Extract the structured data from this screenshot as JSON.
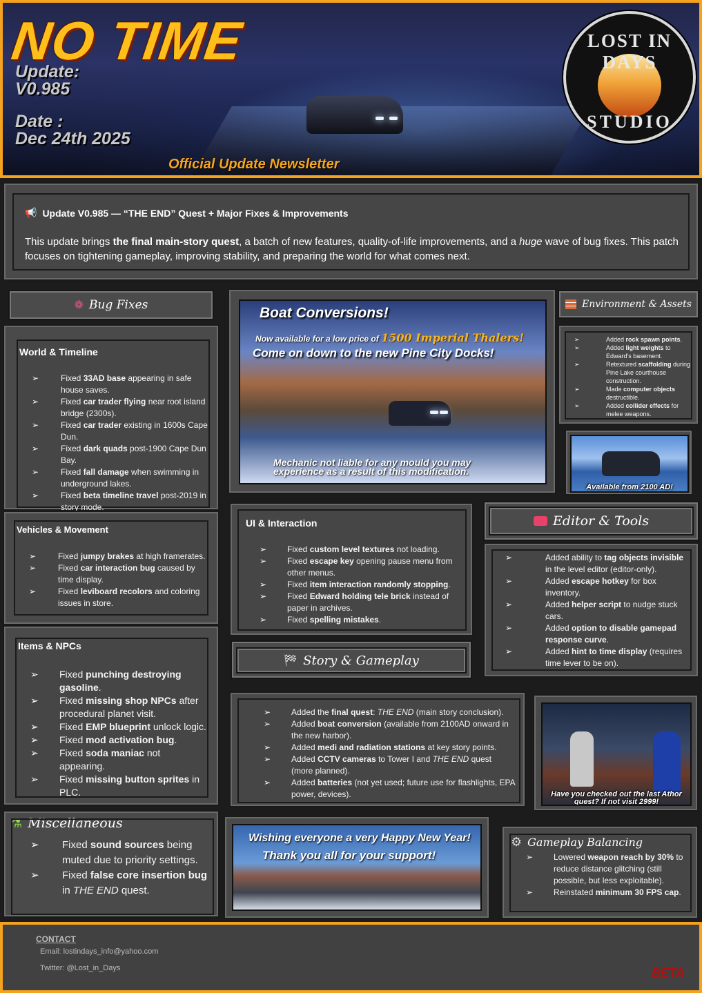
{
  "header": {
    "title": "NO TIME",
    "update_label": "Update:",
    "version": "V0.985",
    "date_label": "Date :",
    "date": "Dec 24th 2025",
    "newsletter": "Official Update Newsletter",
    "studio_top": "LOST IN DAYS",
    "studio_bottom": "STUDIO"
  },
  "intro": {
    "title": "Update V0.985 — “THE END” Quest + Major Fixes & Improvements",
    "body_1": "This update brings ",
    "body_bold": "the final main-story quest",
    "body_2": ", a batch of new features, quality-of-life improvements, and a ",
    "body_italic": "huge",
    "body_3": " wave of bug fixes. This patch focuses on tightening gameplay, improving stability, and preparing the world for what comes next."
  },
  "bug_fixes": {
    "heading": "Bug Fixes",
    "world": {
      "title": "World & Timeline",
      "items": [
        [
          "Fixed ",
          "33AD base",
          " appearing in safe house saves."
        ],
        [
          "Fixed ",
          "car trader flying",
          " near root island bridge (2300s)."
        ],
        [
          "Fixed ",
          "car trader",
          " existing in 1600s Cape Dun."
        ],
        [
          "Fixed ",
          "dark quads",
          " post-1900 Cape Dun Bay."
        ],
        [
          "Fixed ",
          "fall damage",
          " when swimming in underground lakes."
        ],
        [
          "Fixed ",
          "beta timeline travel",
          " post-2019 in story mode."
        ]
      ]
    },
    "vehicles": {
      "title": "Vehicles & Movement",
      "items": [
        [
          "Fixed ",
          "jumpy brakes",
          " at high framerates."
        ],
        [
          "Fixed ",
          "car interaction bug",
          " caused by time display."
        ],
        [
          "Fixed ",
          "leviboard recolors",
          " and coloring issues in store."
        ]
      ]
    },
    "items_npcs": {
      "title": "Items & NPCs",
      "items": [
        [
          "Fixed ",
          "punching destroying gasoline",
          "."
        ],
        [
          "Fixed ",
          "missing shop NPCs",
          " after procedural planet visit."
        ],
        [
          "Fixed ",
          "EMP blueprint",
          " unlock logic."
        ],
        [
          "Fixed ",
          "mod activation bug",
          "."
        ],
        [
          "Fixed ",
          "soda maniac",
          " not appearing."
        ],
        [
          "Fixed ",
          "missing button sprites",
          " in PLC."
        ]
      ]
    }
  },
  "misc": {
    "heading": "Miscellaneous",
    "items": [
      [
        "Fixed ",
        "sound sources",
        " being muted due to priority settings."
      ],
      [
        "Fixed ",
        "false core insertion bug",
        " in ",
        "THE END",
        " quest."
      ]
    ]
  },
  "boat_ad": {
    "title": "Boat Conversions!",
    "price_pre": "Now available for a low price of",
    "price": "1500 Imperial Thalers!",
    "tagline": "Come on down to the new Pine City Docks!",
    "disclaimer": "Mechanic not liable for any mould you may experience as a result of this modification."
  },
  "ui": {
    "title": "UI & Interaction",
    "items": [
      [
        "Fixed ",
        "custom level textures",
        " not loading."
      ],
      [
        "Fixed ",
        "escape key",
        " opening pause menu from other menus."
      ],
      [
        "Fixed ",
        "item interaction randomly stopping",
        "."
      ],
      [
        "Fixed ",
        "Edward holding tele brick",
        " instead of paper in archives."
      ],
      [
        "Fixed ",
        "spelling mistakes",
        "."
      ]
    ]
  },
  "story": {
    "heading": "Story & Gameplay",
    "items": [
      [
        "Added the ",
        "final quest",
        ": ",
        "THE END",
        " (main story conclusion)."
      ],
      [
        "Added ",
        "boat conversion",
        " (available from 2100AD onward in the new harbor).",
        "",
        ""
      ],
      [
        "Added ",
        "medi and radiation stations",
        " at key story points.",
        "",
        ""
      ],
      [
        "Added ",
        "CCTV cameras",
        " to Tower I and ",
        "THE END",
        " quest (more planned)."
      ],
      [
        "Added ",
        "batteries",
        " (not yet used; future use for flashlights, EPA power, devices).",
        "",
        ""
      ]
    ]
  },
  "environment": {
    "heading": "Environment & Assets",
    "items": [
      [
        "Added ",
        "rock spawn points",
        "."
      ],
      [
        "Added ",
        "light weights",
        " to Edward's basement."
      ],
      [
        "Retextured ",
        "scaffolding",
        " during Pine Lake courthouse construction."
      ],
      [
        "Made ",
        "computer objects",
        " destructible."
      ],
      [
        "Added ",
        "collider effects",
        " for melee weapons."
      ]
    ],
    "image_caption": "Available from 2100 AD!"
  },
  "editor": {
    "heading": "Editor & Tools",
    "items": [
      [
        "Added ability to ",
        "tag objects invisible",
        " in the level editor (editor-only)."
      ],
      [
        "Added ",
        "escape hotkey",
        " for box inventory."
      ],
      [
        "Added ",
        "helper script",
        " to nudge stuck cars."
      ],
      [
        "Added ",
        "option to disable gamepad response curve",
        "."
      ],
      [
        "Added ",
        "hint to time display",
        " (requires time lever to be on)."
      ]
    ]
  },
  "athor": {
    "caption": "Have you checked out the last Athor quest? If not visit 2999!"
  },
  "new_year": {
    "line_1": "Wishing everyone a very Happy New Year!",
    "line_2": "Thank you all for your support!"
  },
  "balancing": {
    "heading": "Gameplay Balancing",
    "items": [
      [
        "Lowered ",
        "weapon reach by 30%",
        " to reduce distance glitching (still possible, but less exploitable)."
      ],
      [
        "Reinstated ",
        "minimum 30 FPS cap",
        "."
      ]
    ]
  },
  "footer": {
    "contact_label": "CONTACT",
    "email": "Email: lostindays_info@yahoo.com",
    "twitter": "Twitter:  @Lost_in_Days",
    "beta": "BETA"
  },
  "colors": {
    "accent": "#f5a21e",
    "panel": "#4a4a4a",
    "beta": "#b01010"
  }
}
